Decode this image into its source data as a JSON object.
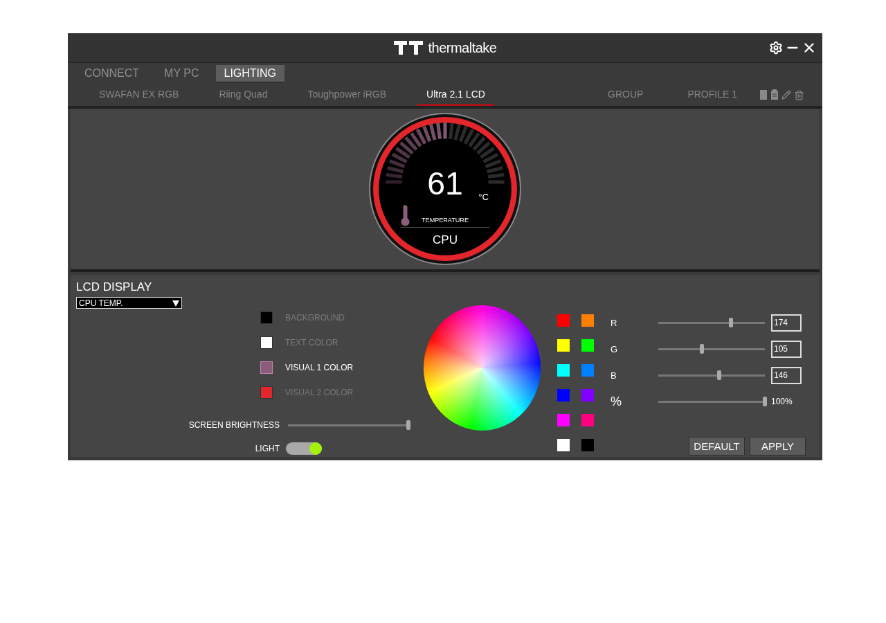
{
  "title_bar": {
    "brand": "thermaltake"
  },
  "main_tabs": [
    {
      "label": "CONNECT",
      "selected": false
    },
    {
      "label": "MY PC",
      "selected": false
    },
    {
      "label": "LIGHTING",
      "selected": true
    }
  ],
  "device_tabs": [
    {
      "label": "SWAFAN EX RGB",
      "selected": false
    },
    {
      "label": "Riing Quad",
      "selected": false
    },
    {
      "label": "Toughpower iRGB",
      "selected": false
    },
    {
      "label": "Ultra 2.1 LCD",
      "selected": true
    }
  ],
  "group_label": "GROUP",
  "profile_label": "PROFILE 1",
  "lcd_preview": {
    "value": "61",
    "unit": "°C",
    "label": "TEMPERATURE",
    "source": "CPU",
    "level": 0.5
  },
  "lcd_display": {
    "title": "LCD DISPLAY",
    "mode": "CPU TEMP.",
    "color_targets": [
      {
        "label": "BACKGROUND",
        "color": "#000000",
        "selected": false
      },
      {
        "label": "TEXT COLOR",
        "color": "#ffffff",
        "selected": false
      },
      {
        "label": "VISUAL 1 COLOR",
        "color": "#8a5d7a",
        "selected": true
      },
      {
        "label": "VISUAL 2 COLOR",
        "color": "#e3262c",
        "selected": false
      }
    ],
    "brightness": {
      "label": "SCREEN BRIGHTNESS",
      "level": 1
    },
    "light": {
      "label": "LIGHT",
      "on": true
    }
  },
  "swatches": [
    {
      "color": "#ff0000"
    },
    {
      "color": "#ff7f00"
    },
    {
      "color": "#ffff00"
    },
    {
      "color": "#00ff00"
    },
    {
      "color": "#00ffff"
    },
    {
      "color": "#007fff"
    },
    {
      "color": "#0000ff"
    },
    {
      "color": "#7f00ff"
    },
    {
      "color": "#ff00ff"
    },
    {
      "color": "#ff007f"
    },
    {
      "color": "#ffffff"
    },
    {
      "color": "#000000"
    }
  ],
  "channels": [
    {
      "label": "R",
      "level": 0.68,
      "value": "174"
    },
    {
      "label": "G",
      "level": 0.41,
      "value": "105"
    },
    {
      "label": "B",
      "level": 0.57,
      "value": "146"
    }
  ],
  "percent": {
    "label": "%",
    "level": 1,
    "reading": "100%"
  },
  "buttons": [
    "DEFAULT",
    "APPLY"
  ]
}
